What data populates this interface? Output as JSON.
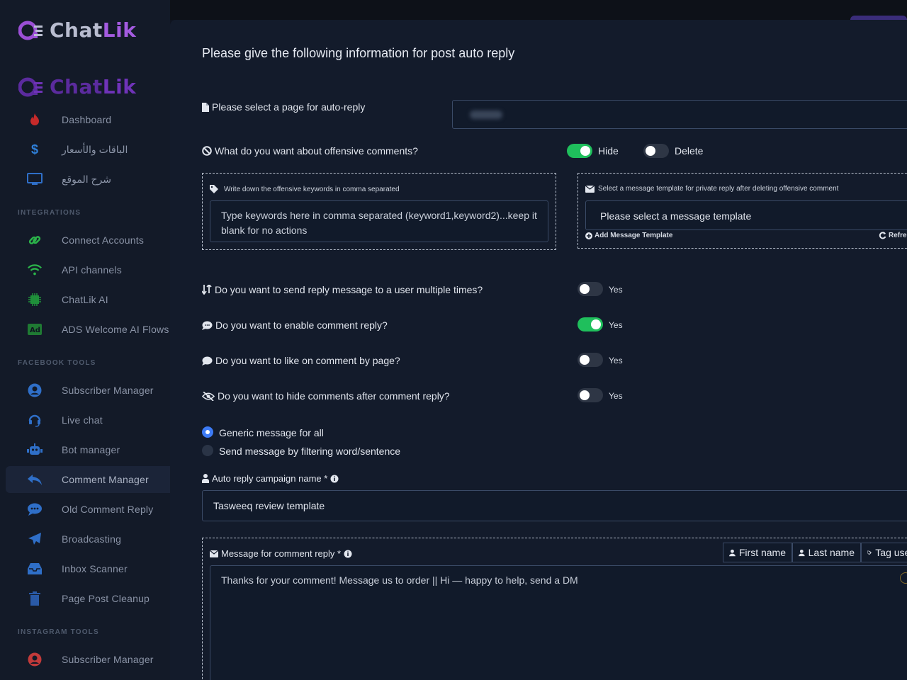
{
  "brand": {
    "name_part1": "Chat",
    "name_part2": "Lik"
  },
  "sidebar": {
    "items_top": [
      {
        "label": "Dashboard",
        "icon": "fire-icon"
      },
      {
        "label": "الباقات والأسعار",
        "icon": "dollar-icon"
      },
      {
        "label": "شرح الموقع",
        "icon": "monitor-icon"
      }
    ],
    "integrations_heading": "INTEGRATIONS",
    "integrations": [
      {
        "label": "Connect Accounts",
        "icon": "link-icon"
      },
      {
        "label": "API channels",
        "icon": "wifi-icon"
      },
      {
        "label": "ChatLik AI",
        "icon": "chip-icon"
      },
      {
        "label": "ADS Welcome AI Flows",
        "icon": "ad-icon"
      }
    ],
    "facebook_heading": "FACEBOOK TOOLS",
    "facebook": [
      {
        "label": "Subscriber Manager",
        "icon": "user-circle-icon"
      },
      {
        "label": "Live chat",
        "icon": "headset-icon"
      },
      {
        "label": "Bot manager",
        "icon": "robot-icon"
      },
      {
        "label": "Comment Manager",
        "icon": "reply-all-icon",
        "active": true
      },
      {
        "label": "Old Comment Reply",
        "icon": "comment-dots-icon"
      },
      {
        "label": "Broadcasting",
        "icon": "paper-plane-icon"
      },
      {
        "label": "Inbox Scanner",
        "icon": "inbox-icon"
      },
      {
        "label": "Page Post Cleanup",
        "icon": "trash-icon"
      }
    ],
    "instagram_heading": "INSTAGRAM TOOLS",
    "instagram": [
      {
        "label": "Subscriber Manager",
        "icon": "user-circle-icon"
      }
    ]
  },
  "form": {
    "title": "Please give the following information for post auto reply",
    "page_select_label": "Please select a page for auto-reply",
    "offensive_question": "What do you want about offensive comments?",
    "hide_label": "Hide",
    "hide_on": true,
    "delete_label": "Delete",
    "delete_on": false,
    "keywords_label": "Write down the offensive keywords in comma separated",
    "keywords_placeholder": "Type keywords here in comma separated (keyword1,keyword2)...keep it blank for no actions",
    "template_label": "Select a message template for private reply after deleting offensive comment",
    "template_select": "Please select a message template",
    "add_template": "Add Message Template",
    "refresh": "Refresh",
    "toggles": [
      {
        "question": "Do you want to send reply message to a user multiple times?",
        "label": "Yes",
        "on": false,
        "icon": "sort-icon"
      },
      {
        "question": "Do you want to enable comment reply?",
        "label": "Yes",
        "on": true,
        "icon": "comment-icon"
      },
      {
        "question": "Do you want to like on comment by page?",
        "label": "Yes",
        "on": false,
        "icon": "comment-icon"
      },
      {
        "question": "Do you want to hide comments after comment reply?",
        "label": "Yes",
        "on": false,
        "icon": "eye-slash-icon"
      }
    ],
    "radio_generic": "Generic message for all",
    "radio_filter": "Send message by filtering word/sentence",
    "campaign_label": "Auto reply campaign name *",
    "campaign_value": "Tasweeq review template",
    "message_label": "Message for comment reply *",
    "chip_first": "First name",
    "chip_last": "Last name",
    "chip_tag": "Tag user",
    "message_value": "Thanks for your comment! Message us to order || Hi — happy to help, send a DM"
  },
  "colors": {
    "accent_purple": "#a45be0",
    "toggle_on": "#1fbf5c",
    "radio_on": "#3d7bf6"
  }
}
